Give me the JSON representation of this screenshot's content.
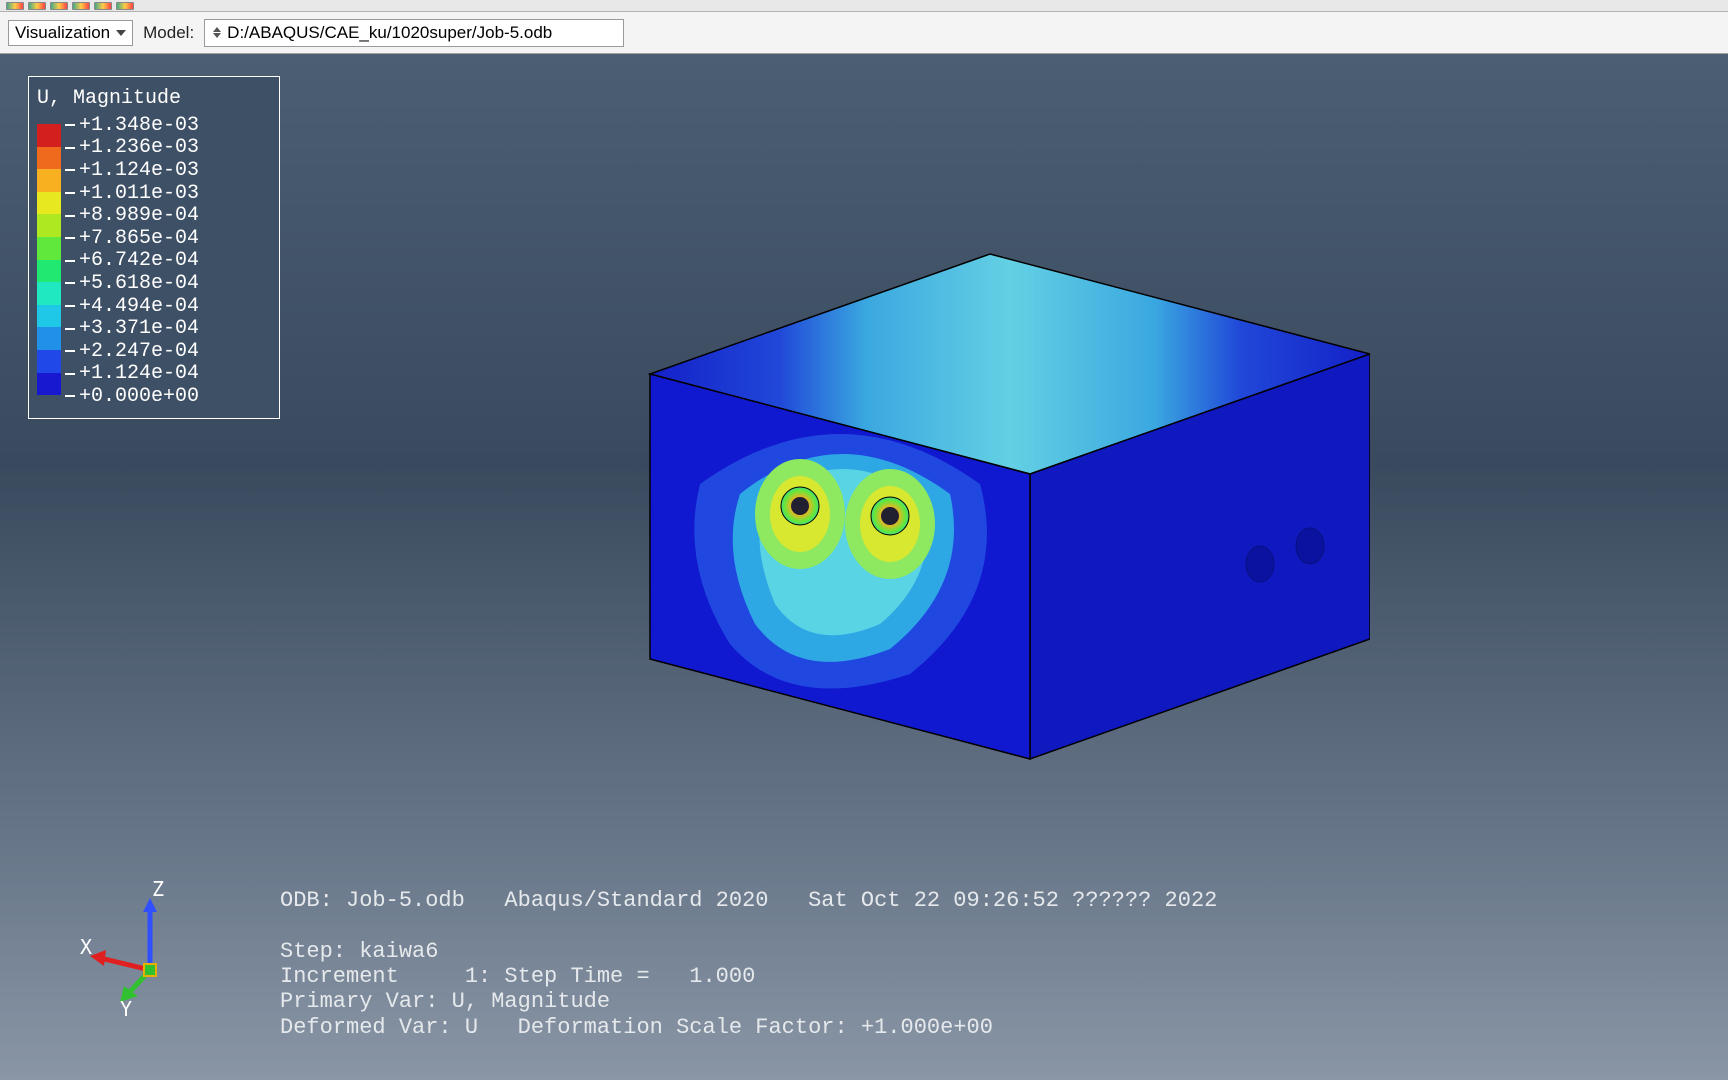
{
  "toolbar": {
    "module_dropdown": "Visualization",
    "model_label": "Model:",
    "model_path": "D:/ABAQUS/CAE_ku/1020super/Job-5.odb"
  },
  "legend": {
    "title": "U, Magnitude",
    "ticks": [
      "+1.348e-03",
      "+1.236e-03",
      "+1.124e-03",
      "+1.011e-03",
      "+8.989e-04",
      "+7.865e-04",
      "+6.742e-04",
      "+5.618e-04",
      "+4.494e-04",
      "+3.371e-04",
      "+2.247e-04",
      "+1.124e-04",
      "+0.000e+00"
    ],
    "colors": [
      "#d3201f",
      "#f06a1e",
      "#f8b020",
      "#e8e820",
      "#aee820",
      "#60e83c",
      "#20e870",
      "#20e8c0",
      "#20c8e8",
      "#2090e8",
      "#2048e8",
      "#1818d0"
    ]
  },
  "triad": {
    "x": "X",
    "y": "Y",
    "z": "Z"
  },
  "status": {
    "line1": "ODB: Job-5.odb   Abaqus/Standard 2020   Sat Oct 22 09:26:52 ?????? 2022",
    "line2": "",
    "line3": "Step: kaiwa6",
    "line4": "Increment     1: Step Time =   1.000",
    "line5": "Primary Var: U, Magnitude",
    "line6": "Deformed Var: U   Deformation Scale Factor: +1.000e+00"
  }
}
